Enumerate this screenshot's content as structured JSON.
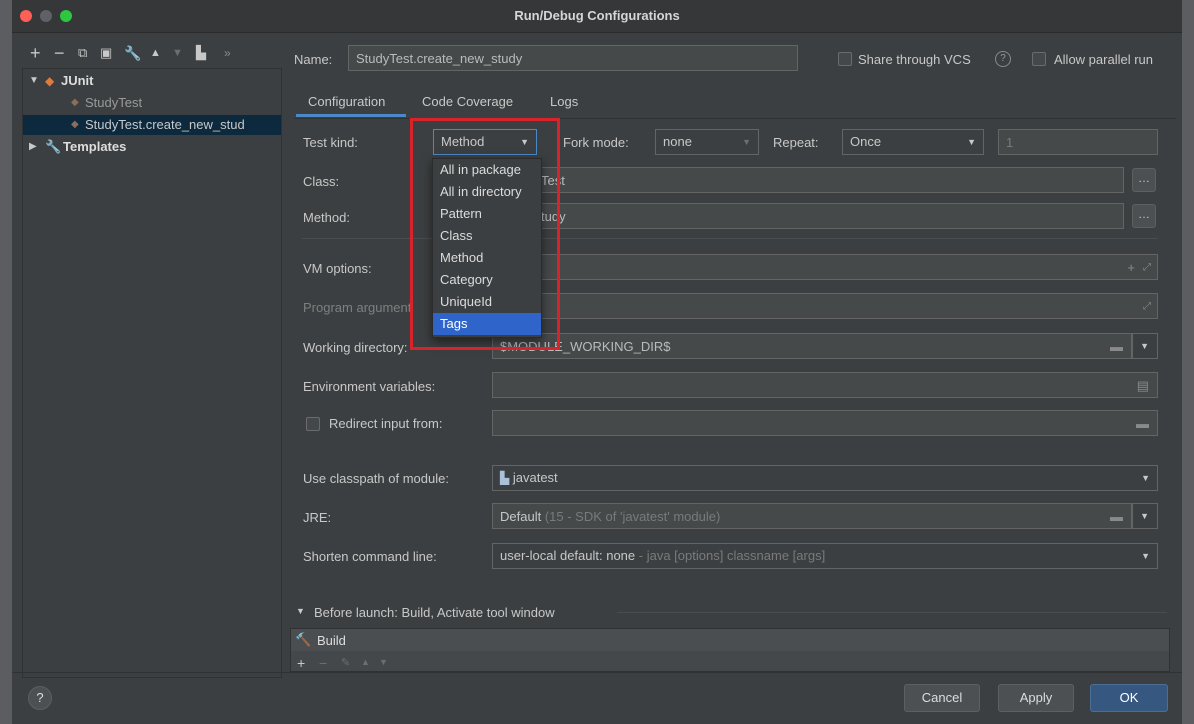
{
  "window": {
    "title": "Run/Debug Configurations"
  },
  "toolbar": {
    "more": "»"
  },
  "tree": {
    "junit": "JUnit",
    "study_test": "StudyTest",
    "create_new_study": "StudyTest.create_new_stud",
    "templates": "Templates"
  },
  "name_row": {
    "label": "Name:",
    "value": "StudyTest.create_new_study",
    "share_vcs": "Share through VCS",
    "allow_parallel": "Allow parallel run"
  },
  "tabs": [
    "Configuration",
    "Code Coverage",
    "Logs"
  ],
  "form": {
    "test_kind_label": "Test kind:",
    "test_kind_value": "Method",
    "fork_mode_label": "Fork mode:",
    "fork_mode_value": "none",
    "repeat_label": "Repeat:",
    "repeat_value": "Once",
    "repeat_count": "1",
    "class_label": "Class:",
    "class_value_visible": "Test",
    "method_label": "Method:",
    "method_value_visible": "tudy",
    "vm_options_label": "VM options:",
    "program_args_label": "Program argument",
    "working_dir_label": "Working directory:",
    "working_dir_value": "$MODULE_WORKING_DIR$",
    "env_vars_label": "Environment variables:",
    "redirect_label": "Redirect input from:",
    "classpath_label": "Use classpath of module:",
    "classpath_value": "javatest",
    "jre_label": "JRE:",
    "jre_value": "Default",
    "jre_hint": "(15 - SDK of 'javatest' module)",
    "shorten_label": "Shorten command line:",
    "shorten_value": "user-local default: none",
    "shorten_hint": "- java [options] classname [args]"
  },
  "test_kind_options": [
    "All in package",
    "All in directory",
    "Pattern",
    "Class",
    "Method",
    "Category",
    "UniqueId",
    "Tags"
  ],
  "before_launch": {
    "title": "Before launch: Build, Activate tool window",
    "item": "Build"
  },
  "buttons": {
    "help": "?",
    "cancel": "Cancel",
    "apply": "Apply",
    "ok": "OK"
  },
  "colors": {
    "accent": "#2f65ca",
    "highlight_box": "#d8232a",
    "background": "#3c3f41"
  }
}
